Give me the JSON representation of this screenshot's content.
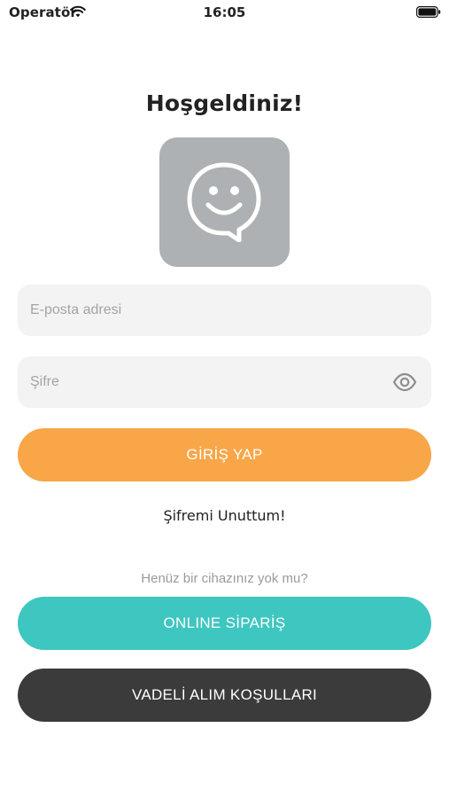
{
  "status_bar": {
    "carrier": "Operatör",
    "time": "16:05",
    "wifi_icon": "wifi-icon",
    "battery_icon": "battery-icon"
  },
  "login": {
    "title": "Hoşgeldiniz!",
    "logo_icon": "smiley-chat-icon",
    "email_placeholder": "E-posta adresi",
    "password_placeholder": "Şifre",
    "password_toggle_icon": "eye-icon",
    "login_button": "GİRİŞ YAP",
    "forgot_password": "Şifremi Unuttum!",
    "no_device_text": "Henüz bir cihazınız yok mu?",
    "online_order_button": "ONLINE SİPARİŞ",
    "terms_button": "VADELİ ALIM KOŞULLARI"
  },
  "colors": {
    "login_button": "#f8a647",
    "online_order_button": "#3ec6c0",
    "terms_button": "#3b3b3b",
    "logo_background": "#adb1b4",
    "field_background": "#f3f3f3"
  }
}
